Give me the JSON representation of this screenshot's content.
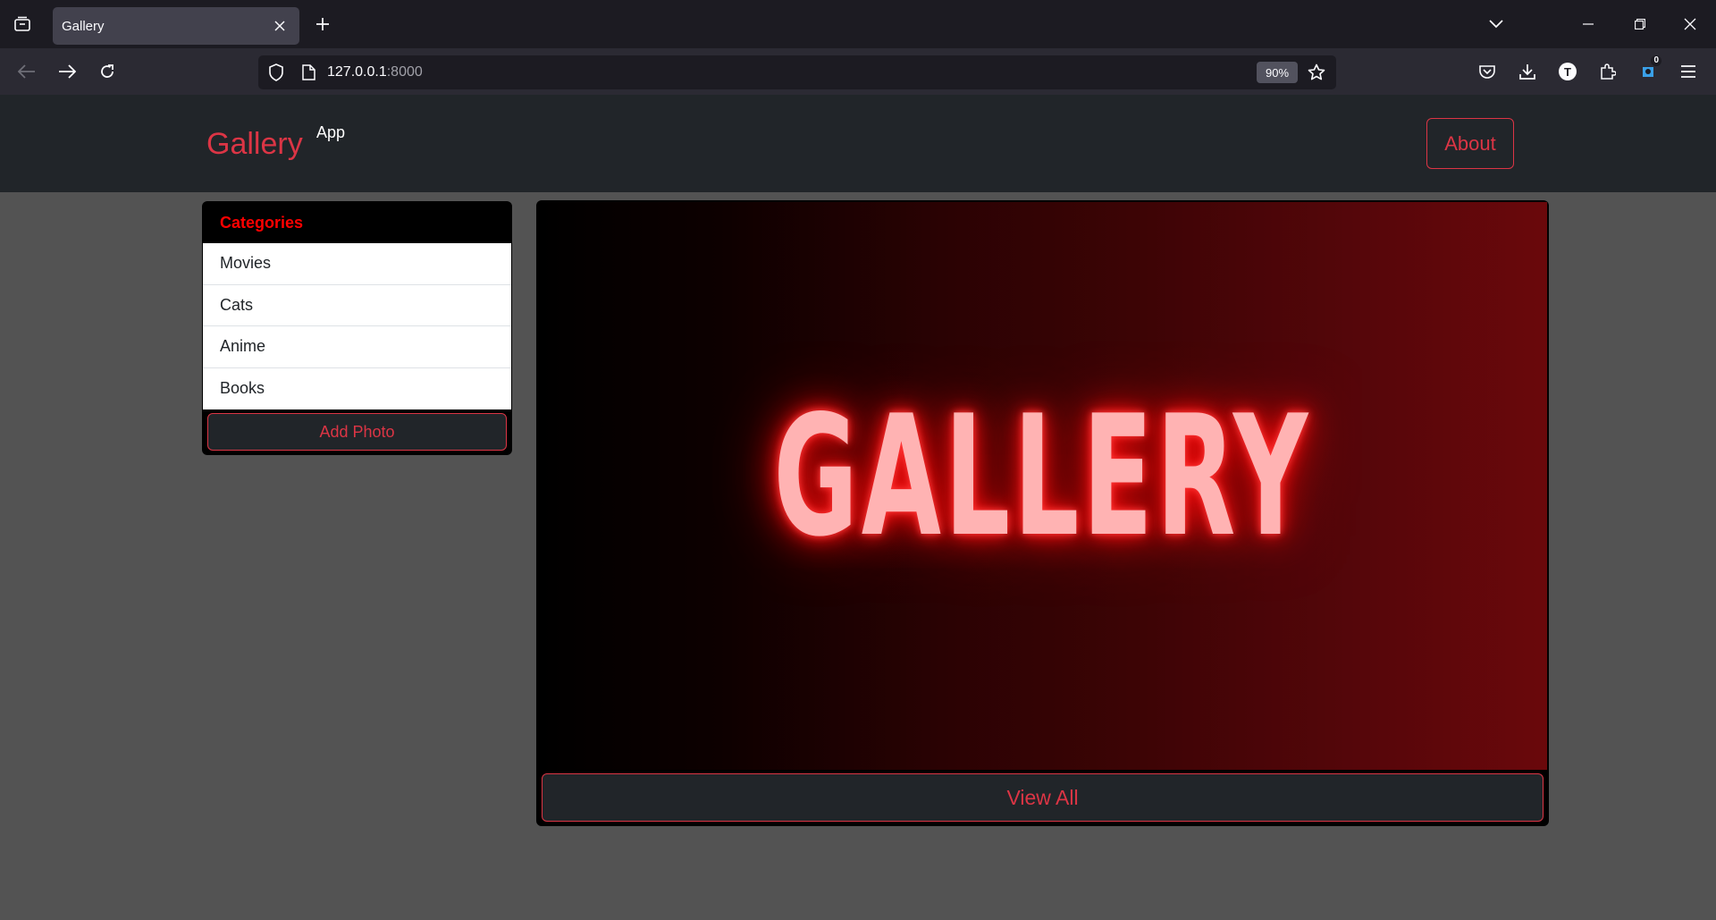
{
  "browser": {
    "tab_title": "Gallery",
    "url_host": "127.0.0.1",
    "url_port": ":8000",
    "zoom": "90%",
    "notification_count": "0",
    "avatar_letter": "T"
  },
  "header": {
    "brand": "Gallery",
    "brand_sup": "App",
    "about_label": "About"
  },
  "sidebar": {
    "title": "Categories",
    "items": [
      {
        "label": "Movies"
      },
      {
        "label": "Cats"
      },
      {
        "label": "Anime"
      },
      {
        "label": "Books"
      }
    ],
    "add_photo_label": "Add Photo"
  },
  "main": {
    "hero_title": "GALLERY",
    "view_all_label": "View All"
  },
  "colors": {
    "accent": "#dc3545",
    "categories_title": "#ff0000",
    "header_bg": "#212529",
    "page_bg": "#535353"
  }
}
